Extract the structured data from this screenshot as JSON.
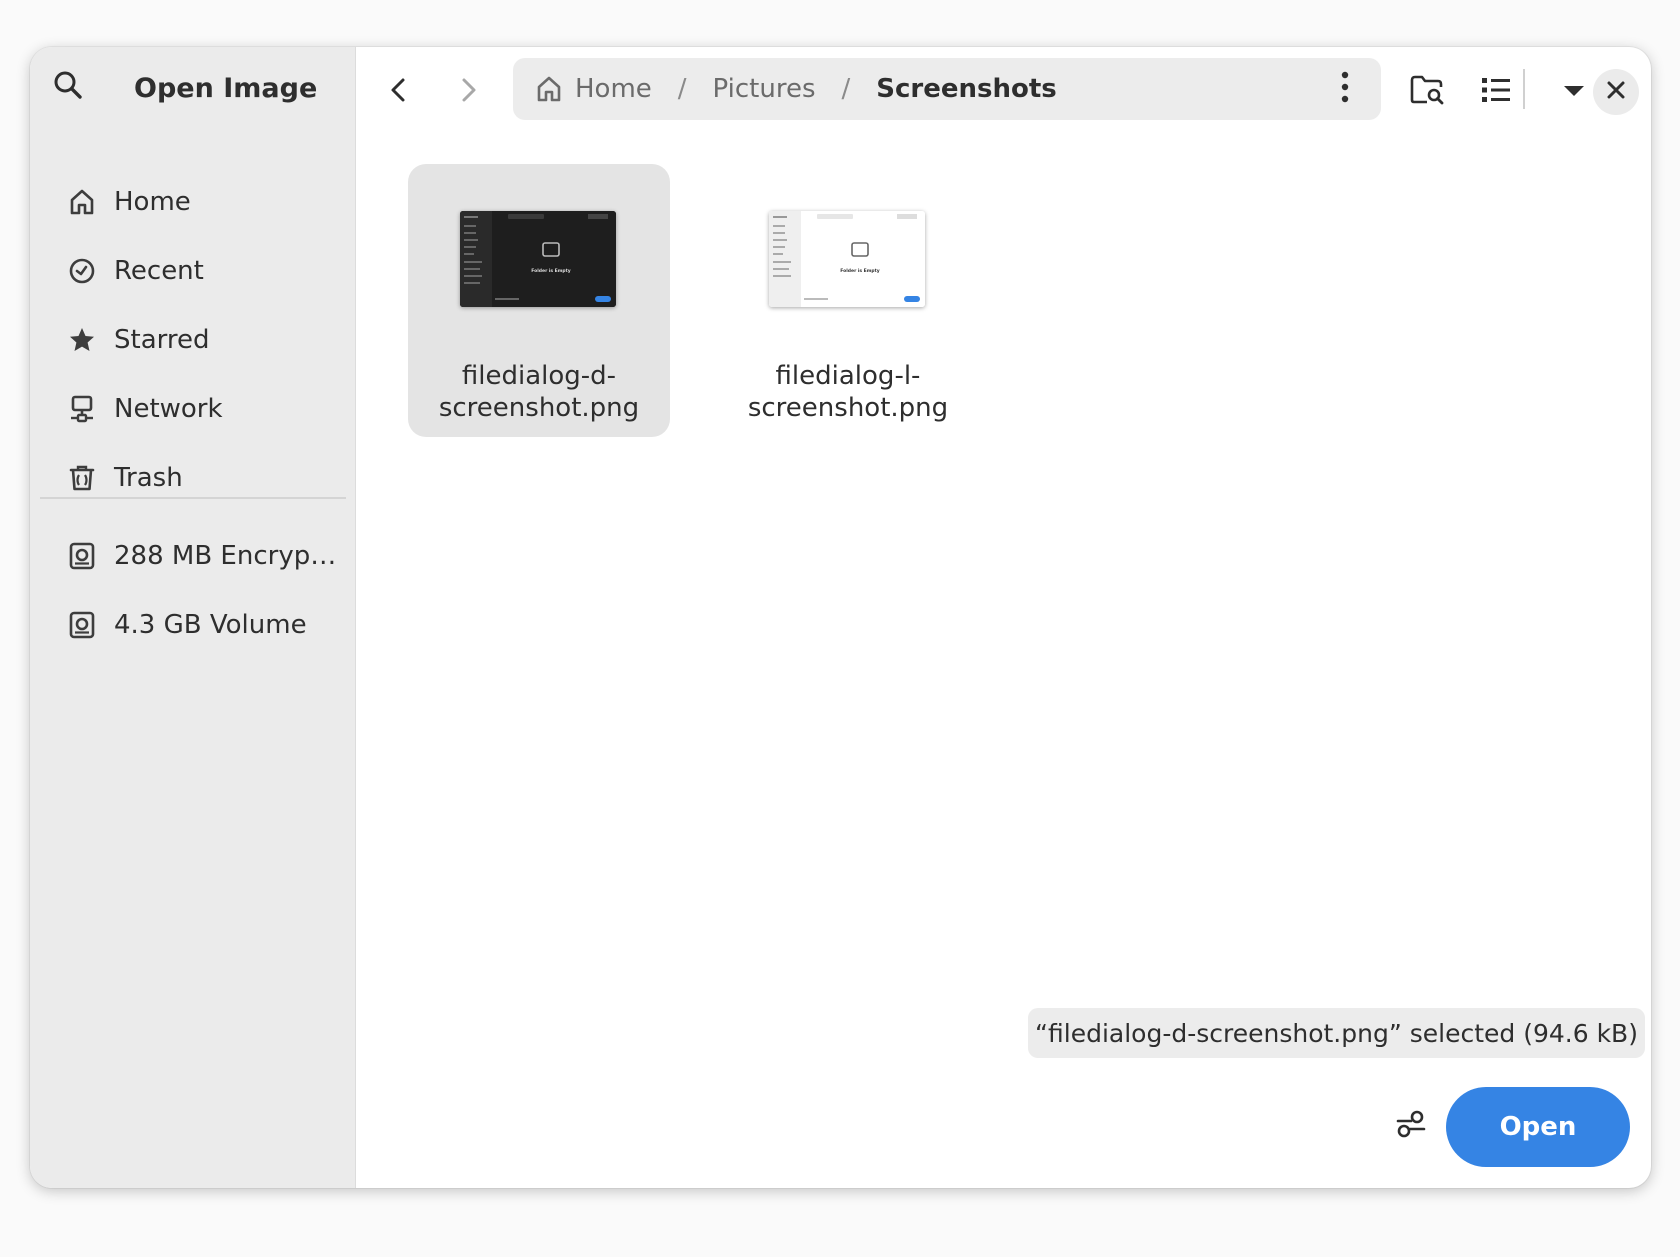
{
  "dialog": {
    "title": "Open Image"
  },
  "sidebar": {
    "places": [
      {
        "label": "Home",
        "icon": "home-icon"
      },
      {
        "label": "Recent",
        "icon": "clock-icon"
      },
      {
        "label": "Starred",
        "icon": "star-icon"
      },
      {
        "label": "Network",
        "icon": "network-icon"
      },
      {
        "label": "Trash",
        "icon": "trash-icon"
      }
    ],
    "volumes": [
      {
        "label": "288 MB Encryp…",
        "icon": "drive-icon"
      },
      {
        "label": "4.3 GB Volume",
        "icon": "drive-icon"
      }
    ]
  },
  "pathbar": {
    "crumbs": [
      "Home",
      "Pictures",
      "Screenshots"
    ],
    "separator": "/"
  },
  "files": [
    {
      "name_line1": "filedialog-d-",
      "name_line2": "screenshot.png",
      "selected": true,
      "theme": "dark"
    },
    {
      "name_line1": "filedialog-l-",
      "name_line2": "screenshot.png",
      "selected": false,
      "theme": "light"
    }
  ],
  "thumbnail_text": "Folder is Empty",
  "status": {
    "text": "“filedialog-d-screenshot.png” selected  (94.6 kB)"
  },
  "actions": {
    "open_label": "Open"
  },
  "colors": {
    "accent": "#3584e4",
    "sidebar_bg": "#ebebeb",
    "selection_bg": "#e4e4e4"
  }
}
